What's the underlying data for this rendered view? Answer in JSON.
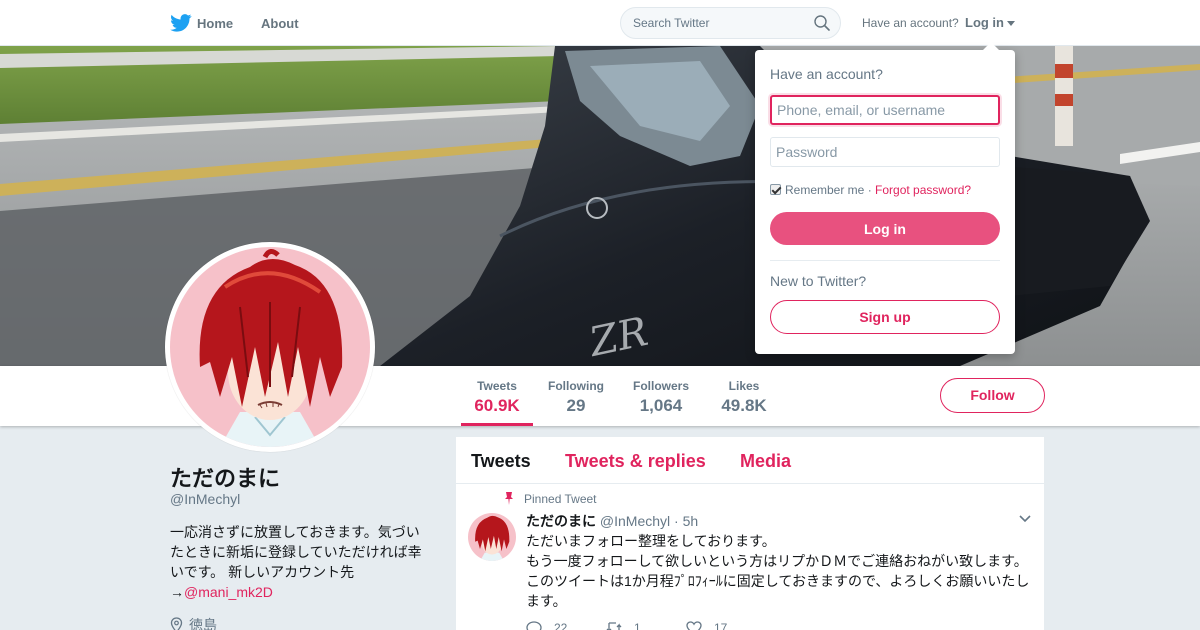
{
  "nav": {
    "home_label": "Home",
    "about_label": "About",
    "search_placeholder": "Search Twitter",
    "have_account": "Have an account?",
    "login_label": "Log in"
  },
  "profile": {
    "name": "ただのまに",
    "handle": "@InMechyl",
    "bio_text": "一応消さずに放置しておきます。気づいたときに新垢に登録していただければ幸いです。 新しいアカウント先",
    "bio_arrow": "→",
    "bio_link": "@mani_mk2D",
    "location": "徳島"
  },
  "stats": [
    {
      "label": "Tweets",
      "value": "60.9K"
    },
    {
      "label": "Following",
      "value": "29"
    },
    {
      "label": "Followers",
      "value": "1,064"
    },
    {
      "label": "Likes",
      "value": "49.8K"
    }
  ],
  "follow_label": "Follow",
  "timeline": {
    "tabs": [
      "Tweets",
      "Tweets & replies",
      "Media"
    ],
    "pinned_label": "Pinned Tweet",
    "tweet": {
      "name": "ただのまに",
      "handle": "@InMechyl",
      "separator": "·",
      "time": "5h",
      "lines": [
        "ただいまフォロー整理をしております。",
        "もう一度フォローして欲しいという方はリプかＤＭでご連絡おねがい致します。",
        "このツイートは1か月程ﾌﾟﾛﾌｨｰﾙに固定しておきますので、よろしくお願いいたします。"
      ],
      "replies": "22",
      "retweets": "1",
      "likes": "17"
    }
  },
  "login_panel": {
    "title": "Have an account?",
    "username_placeholder": "Phone, email, or username",
    "password_placeholder": "Password",
    "remember_label": "Remember me",
    "dot": " · ",
    "forgot_label": "Forgot password?",
    "login_button": "Log in",
    "new_label": "New to Twitter?",
    "signup_button": "Sign up"
  },
  "colors": {
    "accent": "#e0245e",
    "brand_blue": "#1da1f2",
    "page_bg": "#e6ecf0"
  },
  "icons": [
    "twitter-bird-icon",
    "search-icon",
    "caret-down-icon",
    "pin-icon",
    "location-pin-icon",
    "chevron-down-icon",
    "reply-icon",
    "retweet-icon",
    "like-icon"
  ]
}
